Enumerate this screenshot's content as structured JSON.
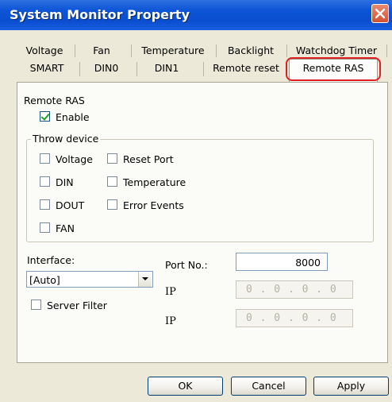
{
  "window": {
    "title": "System Monitor Property"
  },
  "tabs_row1": [
    "Voltage",
    "Fan",
    "Temperature",
    "Backlight",
    "Watchdog Timer"
  ],
  "tabs_row2": [
    "SMART",
    "DIN0",
    "DIN1",
    "Remote reset",
    "Remote RAS"
  ],
  "active_tab": "Remote RAS",
  "remote_ras": {
    "section_label": "Remote RAS",
    "enable_label": "Enable",
    "enable_checked": true
  },
  "throw_device": {
    "title": "Throw device",
    "voltage": "Voltage",
    "reset_port": "Reset Port",
    "din": "DIN",
    "temperature": "Temperature",
    "dout": "DOUT",
    "error_events": "Error Events",
    "fan": "FAN"
  },
  "interface": {
    "label": "Interface:",
    "value": "[Auto]"
  },
  "server_filter": {
    "label": "Server Filter",
    "checked": false
  },
  "port": {
    "label": "Port No.:",
    "value": "8000"
  },
  "ip1": {
    "label": "IP",
    "value": "0 . 0 . 0 . 0"
  },
  "ip2": {
    "label": "IP",
    "value": "0 . 0 . 0 . 0"
  },
  "buttons": {
    "ok": "OK",
    "cancel": "Cancel",
    "apply": "Apply"
  },
  "colors": {
    "title_bar": "#0a4ecf",
    "highlight": "#e02020",
    "dialog_bg": "#ece9d8"
  }
}
